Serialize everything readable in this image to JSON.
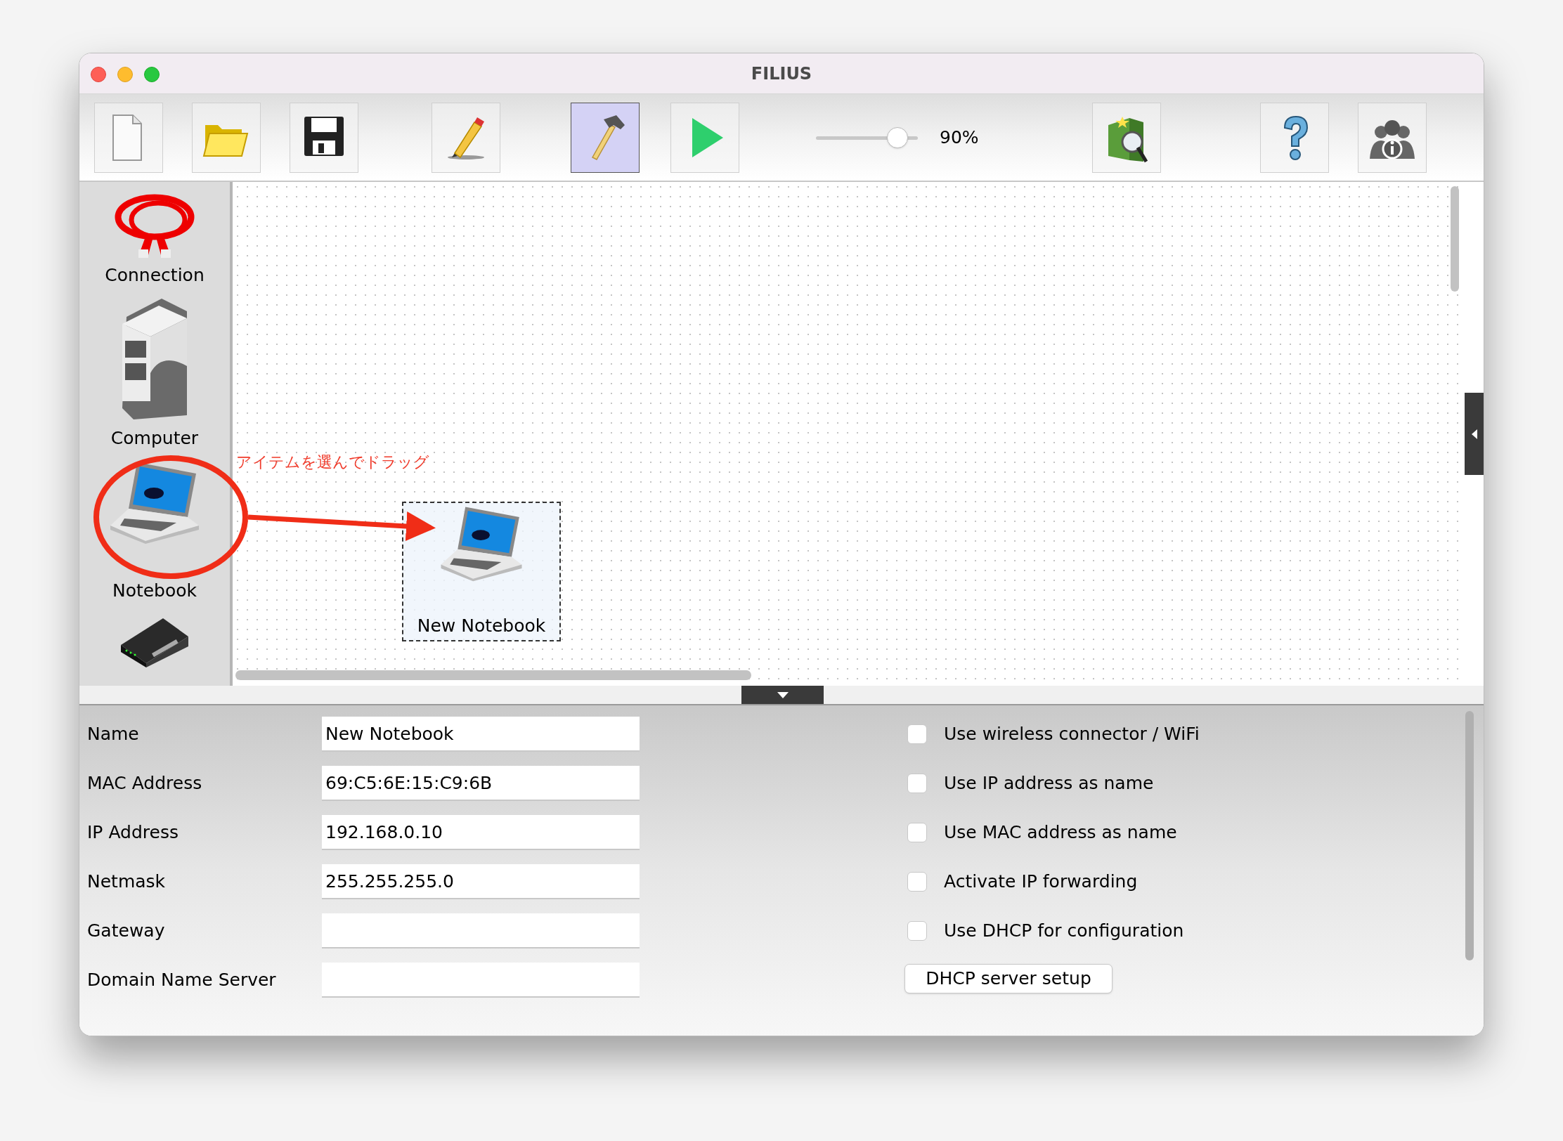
{
  "window": {
    "title": "FILIUS"
  },
  "toolbar": [
    {
      "kind": "new",
      "selected": false
    },
    {
      "kind": "open",
      "selected": false
    },
    {
      "kind": "save",
      "selected": false
    },
    {
      "kind": "edit",
      "selected": false
    },
    {
      "kind": "design",
      "selected": true
    },
    {
      "kind": "run",
      "selected": false
    }
  ],
  "zoom": {
    "level": 0.88,
    "reading": "90%"
  },
  "toolbar_right": [
    {
      "kind": "wizard"
    },
    {
      "kind": "help"
    },
    {
      "kind": "info"
    }
  ],
  "palette": [
    {
      "kind": "cable",
      "label": "Connection"
    },
    {
      "kind": "computer",
      "label": "Computer"
    },
    {
      "kind": "notebook",
      "label": "Notebook"
    },
    {
      "kind": "switch"
    }
  ],
  "canvas": {
    "hint": "アイテムを選んでドラッグ",
    "nodes": [
      {
        "kind": "notebook",
        "label": "New Notebook",
        "selected": true
      }
    ]
  },
  "properties": {
    "fields": [
      {
        "label": "Name",
        "value": "New Notebook"
      },
      {
        "label": "MAC Address",
        "value": "69:C5:6E:15:C9:6B"
      },
      {
        "label": "IP Address",
        "value": "192.168.0.10"
      },
      {
        "label": "Netmask",
        "value": "255.255.255.0"
      },
      {
        "label": "Gateway"
      },
      {
        "label": "Domain Name Server"
      }
    ],
    "options": [
      {
        "label": "Use wireless connector / WiFi",
        "checked": false
      },
      {
        "label": "Use IP address as name",
        "checked": false
      },
      {
        "label": "Use MAC address as name",
        "checked": false
      },
      {
        "label": "Activate IP forwarding",
        "checked": false
      },
      {
        "label": "Use DHCP for configuration",
        "checked": false
      }
    ],
    "button": "DHCP server setup"
  }
}
